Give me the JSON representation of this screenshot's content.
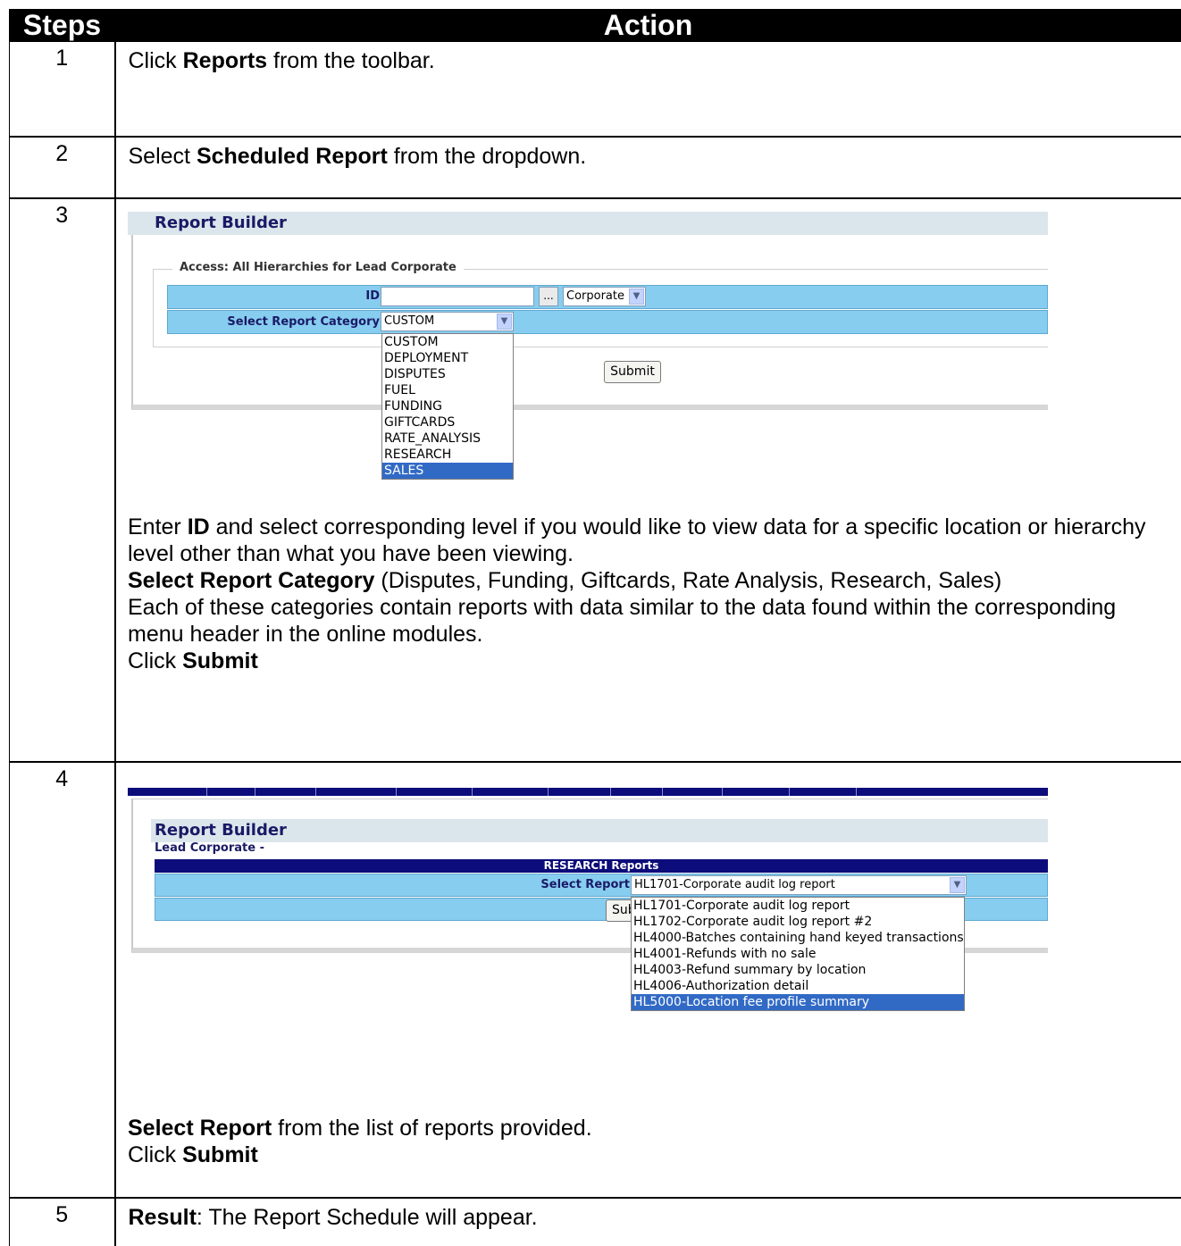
{
  "headers": {
    "steps": "Steps",
    "action": "Action"
  },
  "rows": [
    {
      "num": "1",
      "pre": "Click ",
      "bold": "Reports",
      "post": " from the toolbar."
    },
    {
      "num": "2",
      "pre": "Select ",
      "bold": "Scheduled Report",
      "post": " from the dropdown."
    },
    {
      "num": "3"
    },
    {
      "num": "4"
    },
    {
      "num": "5",
      "pre": "",
      "bold": "Result",
      "post": ": The Report Schedule will appear."
    }
  ],
  "step3": {
    "screenshot": {
      "title": "Report Builder",
      "legend": "Access: All Hierarchies for Lead Corporate",
      "id_label": "ID",
      "id_value": "",
      "dots": "...",
      "level_select": "Corporate",
      "category_label": "Select Report Category",
      "category_select": "CUSTOM",
      "options": [
        "CUSTOM",
        "DEPLOYMENT",
        "DISPUTES",
        "FUEL",
        "FUNDING",
        "GIFTCARDS",
        "RATE_ANALYSIS",
        "RESEARCH",
        "SALES"
      ],
      "highlighted": "SALES",
      "submit": "Submit"
    },
    "text": {
      "p1_a": "Enter ",
      "p1_b": "ID",
      "p1_c": " and select corresponding level if you would like to view data for a specific location or hierarchy level other than what you have been viewing.",
      "p2_b": "Select Report Category",
      "p2_c": " (Disputes, Funding, Giftcards, Rate Analysis, Research, Sales)",
      "p3": "Each of these categories contain reports with data similar to the data found within the corresponding menu header in the online modules.",
      "p4_a": "Click ",
      "p4_b": "Submit"
    }
  },
  "step4": {
    "screenshot": {
      "title": "Report Builder",
      "subtitle": "Lead Corporate -",
      "bar_title": "RESEARCH Reports",
      "select_label": "Select Report",
      "select_value": "HL1701-Corporate audit log report",
      "submit_partial": "Sub",
      "options": [
        "HL1701-Corporate audit log report",
        "HL1702-Corporate audit log report #2",
        "HL4000-Batches containing hand keyed transactions",
        "HL4001-Refunds with no sale",
        "HL4003-Refund summary by location",
        "HL4006-Authorization detail",
        "HL5000-Location fee profile summary"
      ],
      "highlighted": "HL5000-Location fee profile summary"
    },
    "text": {
      "p1_b": "Select Report",
      "p1_c": " from the list of reports provided.",
      "p2_a": "Click ",
      "p2_b": "Submit"
    }
  },
  "colors": {
    "header_bg": "#000000",
    "panel_blue": "#87cdf0",
    "nav_dark": "#0c0c7a",
    "highlight": "#316ac5",
    "title_bg": "#dbe6ec"
  }
}
